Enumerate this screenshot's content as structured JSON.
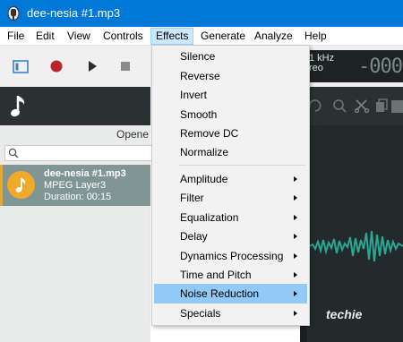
{
  "window": {
    "title": "dee-nesia #1.mp3",
    "icon": "app-icon",
    "titlebar_color": "#0078d7"
  },
  "menubar": {
    "items": [
      "File",
      "Edit",
      "View",
      "Controls",
      "Effects",
      "Generate",
      "Analyze",
      "Help"
    ],
    "active": "Effects"
  },
  "toolbar": {
    "buttons": [
      "view-toggle-icon",
      "record-icon",
      "play-icon",
      "stop-icon"
    ]
  },
  "display": {
    "line1": "1 kHz",
    "line2": "reo",
    "readout": "-000"
  },
  "left_panel": {
    "header_icon": "music-note-icon",
    "opened_label": "Opene",
    "search_icon": "search-icon",
    "file": {
      "title": "dee-nesia #1.mp3",
      "format": "MPEG Layer3",
      "duration": "Duration: 00:15"
    }
  },
  "effects_menu": {
    "group1": [
      "Silence",
      "Reverse",
      "Invert",
      "Smooth",
      "Remove DC",
      "Normalize"
    ],
    "group2": [
      "Amplitude",
      "Filter",
      "Equalization",
      "Delay",
      "Dynamics Processing",
      "Time and Pitch",
      "Noise Reduction",
      "Specials"
    ],
    "highlighted": "Noise Reduction"
  },
  "watermark": "techie",
  "colors": {
    "accent": "#0078d7",
    "menu_highlight": "#91c9f7",
    "file_selected": "#7f9695",
    "note_orange": "#f0a92b",
    "record_red": "#b8262b"
  }
}
